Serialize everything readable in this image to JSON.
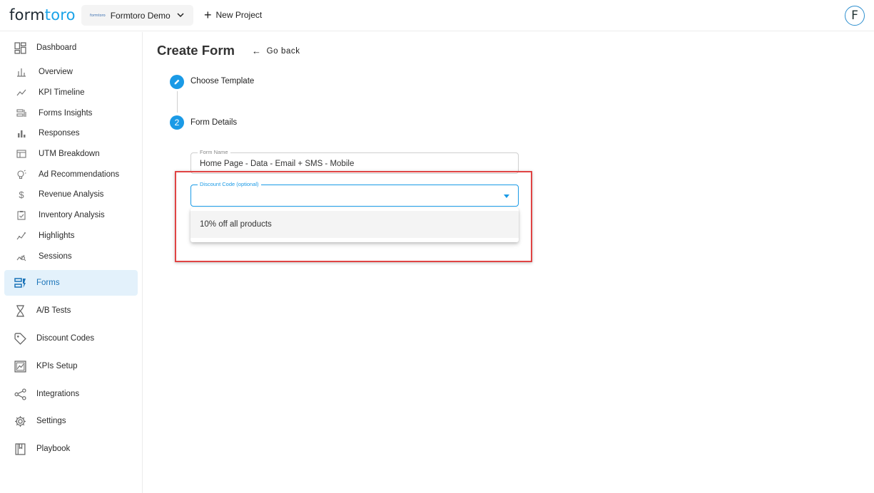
{
  "app": {
    "logo_text_a": "form",
    "logo_text_b": "toro",
    "project_mini_logo": "formtoro",
    "project_name": "Formtoro Demo",
    "new_project_label": "New Project",
    "avatar_letter": "F",
    "accent_color": "#1a9ae6"
  },
  "sidebar": {
    "items": [
      {
        "label": "Dashboard",
        "icon": "dashboard-icon"
      },
      {
        "label": "Overview",
        "icon": "bar-chart-icon"
      },
      {
        "label": "KPI Timeline",
        "icon": "trend-line-icon"
      },
      {
        "label": "Forms Insights",
        "icon": "forms-insights-icon"
      },
      {
        "label": "Responses",
        "icon": "responses-bar-icon"
      },
      {
        "label": "UTM Breakdown",
        "icon": "table-icon"
      },
      {
        "label": "Ad Recommendations",
        "icon": "lightbulb-icon"
      },
      {
        "label": "Revenue Analysis",
        "icon": "dollar-icon"
      },
      {
        "label": "Inventory Analysis",
        "icon": "clipboard-icon"
      },
      {
        "label": "Highlights",
        "icon": "sparkline-icon"
      },
      {
        "label": "Sessions",
        "icon": "sessions-icon"
      },
      {
        "label": "Forms",
        "icon": "forms-icon"
      },
      {
        "label": "A/B Tests",
        "icon": "hourglass-icon"
      },
      {
        "label": "Discount Codes",
        "icon": "tag-icon"
      },
      {
        "label": "KPIs Setup",
        "icon": "kpi-image-icon"
      },
      {
        "label": "Integrations",
        "icon": "share-icon"
      },
      {
        "label": "Settings",
        "icon": "gear-icon"
      },
      {
        "label": "Playbook",
        "icon": "book-icon"
      }
    ],
    "active": "Forms"
  },
  "main": {
    "title": "Create Form",
    "go_back_label": "Go back",
    "steps": [
      {
        "marker": "",
        "label": "Choose Template"
      },
      {
        "marker": "2",
        "label": "Form Details"
      }
    ],
    "form_name": {
      "legend": "Form Name",
      "value": "Home Page - Data - Email + SMS - Mobile"
    },
    "discount_code": {
      "legend": "Discount Code (optional)",
      "value": "",
      "options": [
        "10% off all products"
      ]
    }
  }
}
